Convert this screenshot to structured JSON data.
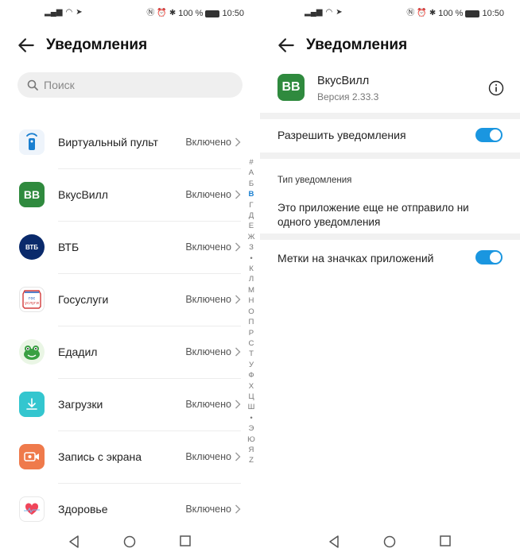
{
  "status_bar": {
    "battery": "100 %",
    "time": "10:50"
  },
  "left": {
    "title": "Уведомления",
    "search": {
      "placeholder": "Поиск"
    },
    "apps": [
      {
        "name": "Виртуальный пульт",
        "state": "Включено",
        "icon": "remote-icon",
        "color": "#e8f1fb"
      },
      {
        "name": "ВкусВилл",
        "state": "Включено",
        "icon": "vkusvill-icon",
        "color": "#2f8a3e",
        "icon_text": "BB"
      },
      {
        "name": "ВТБ",
        "state": "Включено",
        "icon": "vtb-icon",
        "color": "#0a2a6b",
        "icon_text": "ВТБ"
      },
      {
        "name": "Госуслуги",
        "state": "Включено",
        "icon": "gosuslugi-icon",
        "color": "#ffffff",
        "icon_text": "гос услуги"
      },
      {
        "name": "Едадил",
        "state": "Включено",
        "icon": "edadil-icon",
        "color": "#e9f6e4"
      },
      {
        "name": "Загрузки",
        "state": "Включено",
        "icon": "downloads-icon",
        "color": "#2fc7cf"
      },
      {
        "name": "Запись с экрана",
        "state": "Включено",
        "icon": "screen-record-icon",
        "color": "#f07a4a"
      },
      {
        "name": "Здоровье",
        "state": "Включено",
        "icon": "health-icon",
        "color": "#ffffff"
      }
    ],
    "alphabet": [
      "#",
      "А",
      "Б",
      "В",
      "Г",
      "Д",
      "Е",
      "Ж",
      "З",
      "•",
      "К",
      "Л",
      "М",
      "Н",
      "О",
      "П",
      "Р",
      "С",
      "Т",
      "У",
      "Ф",
      "Х",
      "Ц",
      "Ш",
      "•",
      "Э",
      "Ю",
      "Я",
      "Z"
    ],
    "alphabet_active": "В"
  },
  "right": {
    "title": "Уведомления",
    "app": {
      "icon_text": "BB",
      "name": "ВкусВилл",
      "version": "Версия 2.33.3"
    },
    "allow_notifications": {
      "label": "Разрешить уведомления",
      "enabled": true
    },
    "notification_type_label": "Тип уведомления",
    "notice": "Это приложение еще не отправило ни одного уведомления",
    "badges": {
      "label": "Метки на значках приложений",
      "enabled": true
    }
  },
  "colors": {
    "accent": "#1a96e0",
    "vkusvill_green": "#2f8a3e"
  }
}
